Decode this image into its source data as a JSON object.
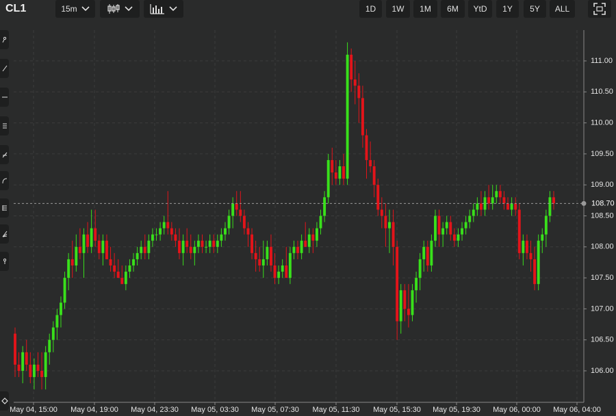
{
  "toolbar": {
    "symbol": "CL1",
    "interval": "15m",
    "chart_type_icon": "candlestick-icon",
    "indicator_icon": "bar-volume-icon",
    "ranges": [
      "1D",
      "1W",
      "1M",
      "6M",
      "YtD",
      "1Y",
      "5Y",
      "ALL"
    ],
    "fullscreen_icon": "fullscreen-icon"
  },
  "tools": [
    "crosshair-icon",
    "trendline-icon",
    "horizontal-line-icon",
    "fib-retracement-icon",
    "pitchfork-icon",
    "arc-icon",
    "gann-icon",
    "fib-fan-icon",
    "measure-icon"
  ],
  "bottom_tool": "settings-diamond-icon",
  "colors": {
    "up": "#39e01b",
    "down": "#e3141a",
    "grid": "#3c3d3d",
    "background": "#2a2b2b"
  },
  "chart_data": {
    "type": "candlestick",
    "y_ticks": [
      "106.00",
      "106.50",
      "107.00",
      "107.50",
      "108.00",
      "108.50",
      "109.00",
      "109.50",
      "110.00",
      "110.50",
      "111.00"
    ],
    "ylim": [
      105.6,
      111.4
    ],
    "x_ticks": [
      "May 04, 15:00",
      "May 04, 19:00",
      "May 04, 23:30",
      "May 05, 03:30",
      "May 05, 07:30",
      "May 05, 11:30",
      "May 05, 15:30",
      "May 05, 19:30",
      "May 06, 00:00",
      "May 06, 04:00"
    ],
    "last_price": "108.70",
    "last_price_value": 108.7,
    "candles": [
      [
        106.6,
        106.7,
        105.9,
        106.1
      ],
      [
        106.1,
        106.3,
        105.9,
        106.0
      ],
      [
        106.0,
        106.4,
        105.8,
        106.3
      ],
      [
        106.3,
        106.5,
        106.0,
        106.1
      ],
      [
        106.1,
        106.3,
        105.8,
        105.9
      ],
      [
        105.9,
        106.2,
        105.7,
        106.1
      ],
      [
        106.1,
        106.3,
        105.9,
        106.0
      ],
      [
        106.0,
        106.3,
        105.7,
        105.9
      ],
      [
        105.9,
        106.4,
        105.7,
        106.3
      ],
      [
        106.3,
        106.6,
        106.1,
        106.5
      ],
      [
        106.5,
        106.8,
        106.3,
        106.7
      ],
      [
        106.7,
        107.0,
        106.5,
        106.9
      ],
      [
        106.9,
        107.2,
        106.7,
        107.1
      ],
      [
        107.1,
        107.6,
        107.0,
        107.5
      ],
      [
        107.5,
        107.9,
        107.3,
        107.8
      ],
      [
        107.8,
        108.1,
        107.5,
        107.7
      ],
      [
        107.7,
        108.2,
        107.6,
        108.0
      ],
      [
        108.0,
        108.3,
        107.8,
        107.9
      ],
      [
        107.9,
        108.3,
        107.5,
        108.2
      ],
      [
        108.2,
        108.4,
        107.9,
        108.0
      ],
      [
        108.0,
        108.6,
        107.9,
        108.3
      ],
      [
        108.3,
        108.6,
        108.0,
        108.1
      ],
      [
        108.1,
        108.2,
        107.8,
        107.9
      ],
      [
        107.9,
        108.2,
        107.7,
        108.1
      ],
      [
        108.1,
        108.2,
        107.9,
        107.8
      ],
      [
        107.8,
        108.0,
        107.6,
        107.7
      ],
      [
        107.7,
        107.9,
        107.5,
        107.6
      ],
      [
        107.6,
        107.8,
        107.5,
        107.5
      ],
      [
        107.5,
        107.7,
        107.4,
        107.4
      ],
      [
        107.4,
        107.7,
        107.3,
        107.6
      ],
      [
        107.6,
        107.8,
        107.5,
        107.7
      ],
      [
        107.7,
        107.9,
        107.6,
        107.8
      ],
      [
        107.8,
        108.0,
        107.7,
        107.9
      ],
      [
        107.9,
        108.1,
        107.8,
        108.0
      ],
      [
        108.0,
        108.2,
        107.8,
        107.9
      ],
      [
        107.9,
        108.2,
        107.8,
        108.1
      ],
      [
        108.1,
        108.3,
        108.0,
        108.2
      ],
      [
        108.2,
        108.3,
        108.1,
        108.2
      ],
      [
        108.2,
        108.4,
        108.1,
        108.3
      ],
      [
        108.3,
        108.5,
        108.2,
        108.4
      ],
      [
        108.4,
        108.9,
        108.2,
        108.3
      ],
      [
        108.3,
        108.4,
        108.1,
        108.2
      ],
      [
        108.2,
        108.3,
        108.0,
        108.1
      ],
      [
        108.1,
        108.3,
        107.8,
        107.9
      ],
      [
        107.9,
        108.2,
        107.7,
        108.1
      ],
      [
        108.1,
        108.3,
        107.9,
        108.0
      ],
      [
        108.0,
        108.2,
        107.8,
        107.9
      ],
      [
        107.9,
        108.1,
        107.7,
        108.0
      ],
      [
        108.0,
        108.2,
        107.9,
        108.1
      ],
      [
        108.1,
        108.2,
        107.9,
        108.0
      ],
      [
        108.0,
        108.1,
        107.9,
        108.0
      ],
      [
        108.0,
        108.2,
        107.9,
        108.1
      ],
      [
        108.1,
        108.2,
        107.9,
        108.0
      ],
      [
        108.0,
        108.2,
        107.9,
        108.1
      ],
      [
        108.1,
        108.3,
        108.0,
        108.2
      ],
      [
        108.2,
        108.4,
        108.1,
        108.3
      ],
      [
        108.3,
        108.6,
        108.2,
        108.5
      ],
      [
        108.5,
        108.8,
        108.3,
        108.7
      ],
      [
        108.7,
        108.9,
        108.5,
        108.6
      ],
      [
        108.6,
        108.9,
        108.4,
        108.5
      ],
      [
        108.5,
        108.6,
        108.2,
        108.3
      ],
      [
        108.3,
        108.4,
        108.0,
        108.2
      ],
      [
        108.2,
        108.3,
        107.8,
        107.9
      ],
      [
        107.9,
        108.1,
        107.6,
        107.8
      ],
      [
        107.8,
        108.0,
        107.6,
        107.7
      ],
      [
        107.7,
        108.1,
        107.5,
        107.8
      ],
      [
        107.8,
        108.1,
        107.7,
        108.0
      ],
      [
        108.0,
        108.2,
        107.6,
        107.7
      ],
      [
        107.7,
        107.9,
        107.4,
        107.5
      ],
      [
        107.5,
        107.7,
        107.4,
        107.6
      ],
      [
        107.6,
        107.8,
        107.5,
        107.7
      ],
      [
        107.7,
        108.0,
        107.6,
        107.5
      ],
      [
        107.5,
        108.0,
        107.4,
        107.9
      ],
      [
        107.9,
        108.1,
        107.8,
        108.0
      ],
      [
        108.0,
        108.1,
        107.8,
        107.9
      ],
      [
        107.9,
        108.2,
        107.8,
        108.1
      ],
      [
        108.1,
        108.4,
        108.0,
        108.0
      ],
      [
        108.0,
        108.3,
        107.9,
        108.2
      ],
      [
        108.2,
        108.3,
        107.9,
        108.1
      ],
      [
        108.1,
        108.4,
        108.0,
        108.3
      ],
      [
        108.3,
        108.6,
        108.2,
        108.5
      ],
      [
        108.5,
        108.9,
        108.4,
        108.8
      ],
      [
        108.8,
        109.5,
        108.7,
        109.4
      ],
      [
        109.4,
        109.6,
        109.0,
        109.2
      ],
      [
        109.2,
        109.4,
        109.0,
        109.1
      ],
      [
        109.1,
        109.4,
        109.0,
        109.3
      ],
      [
        109.3,
        109.5,
        109.0,
        109.1
      ],
      [
        109.1,
        111.3,
        109.0,
        111.1
      ],
      [
        111.1,
        111.2,
        110.5,
        110.7
      ],
      [
        110.7,
        111.0,
        110.3,
        110.6
      ],
      [
        110.6,
        110.8,
        110.0,
        110.4
      ],
      [
        110.4,
        110.6,
        109.6,
        109.8
      ],
      [
        109.8,
        109.9,
        109.1,
        109.4
      ],
      [
        109.4,
        109.7,
        109.2,
        109.3
      ],
      [
        109.3,
        109.4,
        108.8,
        109.0
      ],
      [
        109.0,
        109.1,
        108.5,
        108.6
      ],
      [
        108.6,
        108.8,
        108.3,
        108.5
      ],
      [
        108.5,
        108.7,
        108.0,
        108.3
      ],
      [
        108.3,
        108.6,
        107.9,
        108.4
      ],
      [
        108.4,
        108.6,
        107.7,
        108.0
      ],
      [
        108.0,
        108.1,
        106.5,
        106.8
      ],
      [
        106.8,
        107.4,
        106.6,
        107.3
      ],
      [
        107.3,
        107.4,
        106.8,
        107.0
      ],
      [
        107.0,
        107.4,
        106.7,
        106.9
      ],
      [
        106.9,
        107.4,
        106.8,
        107.3
      ],
      [
        107.3,
        107.6,
        107.1,
        107.5
      ],
      [
        107.5,
        107.9,
        107.3,
        107.8
      ],
      [
        107.8,
        108.1,
        107.6,
        108.0
      ],
      [
        108.0,
        108.1,
        107.6,
        107.7
      ],
      [
        107.7,
        108.2,
        107.6,
        108.1
      ],
      [
        108.1,
        108.6,
        108.0,
        108.5
      ],
      [
        108.5,
        108.6,
        108.0,
        108.2
      ],
      [
        108.2,
        108.4,
        108.0,
        108.3
      ],
      [
        108.3,
        108.5,
        108.2,
        108.4
      ],
      [
        108.4,
        108.5,
        108.1,
        108.2
      ],
      [
        108.2,
        108.3,
        108.0,
        108.1
      ],
      [
        108.1,
        108.3,
        108.0,
        108.2
      ],
      [
        108.2,
        108.4,
        108.1,
        108.3
      ],
      [
        108.3,
        108.5,
        108.2,
        108.4
      ],
      [
        108.4,
        108.6,
        108.3,
        108.5
      ],
      [
        108.5,
        108.7,
        108.4,
        108.6
      ],
      [
        108.6,
        108.8,
        108.5,
        108.7
      ],
      [
        108.7,
        108.9,
        108.5,
        108.6
      ],
      [
        108.6,
        108.9,
        108.5,
        108.8
      ],
      [
        108.8,
        109.0,
        108.6,
        108.7
      ],
      [
        108.7,
        109.0,
        108.6,
        108.8
      ],
      [
        108.8,
        109.0,
        108.7,
        108.9
      ],
      [
        108.9,
        109.0,
        108.7,
        108.8
      ],
      [
        108.8,
        108.9,
        108.6,
        108.7
      ],
      [
        108.7,
        108.8,
        108.6,
        108.6
      ],
      [
        108.6,
        108.8,
        108.5,
        108.7
      ],
      [
        108.7,
        108.8,
        108.5,
        108.6
      ],
      [
        108.6,
        108.7,
        107.8,
        107.9
      ],
      [
        107.9,
        108.2,
        107.7,
        108.1
      ],
      [
        108.1,
        108.2,
        107.8,
        107.9
      ],
      [
        107.9,
        108.1,
        107.6,
        107.8
      ],
      [
        107.8,
        108.0,
        107.3,
        107.4
      ],
      [
        107.4,
        108.2,
        107.3,
        108.1
      ],
      [
        108.1,
        108.3,
        107.9,
        108.2
      ],
      [
        108.2,
        108.6,
        108.0,
        108.5
      ],
      [
        108.5,
        108.9,
        108.4,
        108.8
      ],
      [
        108.8,
        108.9,
        108.6,
        108.7
      ]
    ]
  }
}
